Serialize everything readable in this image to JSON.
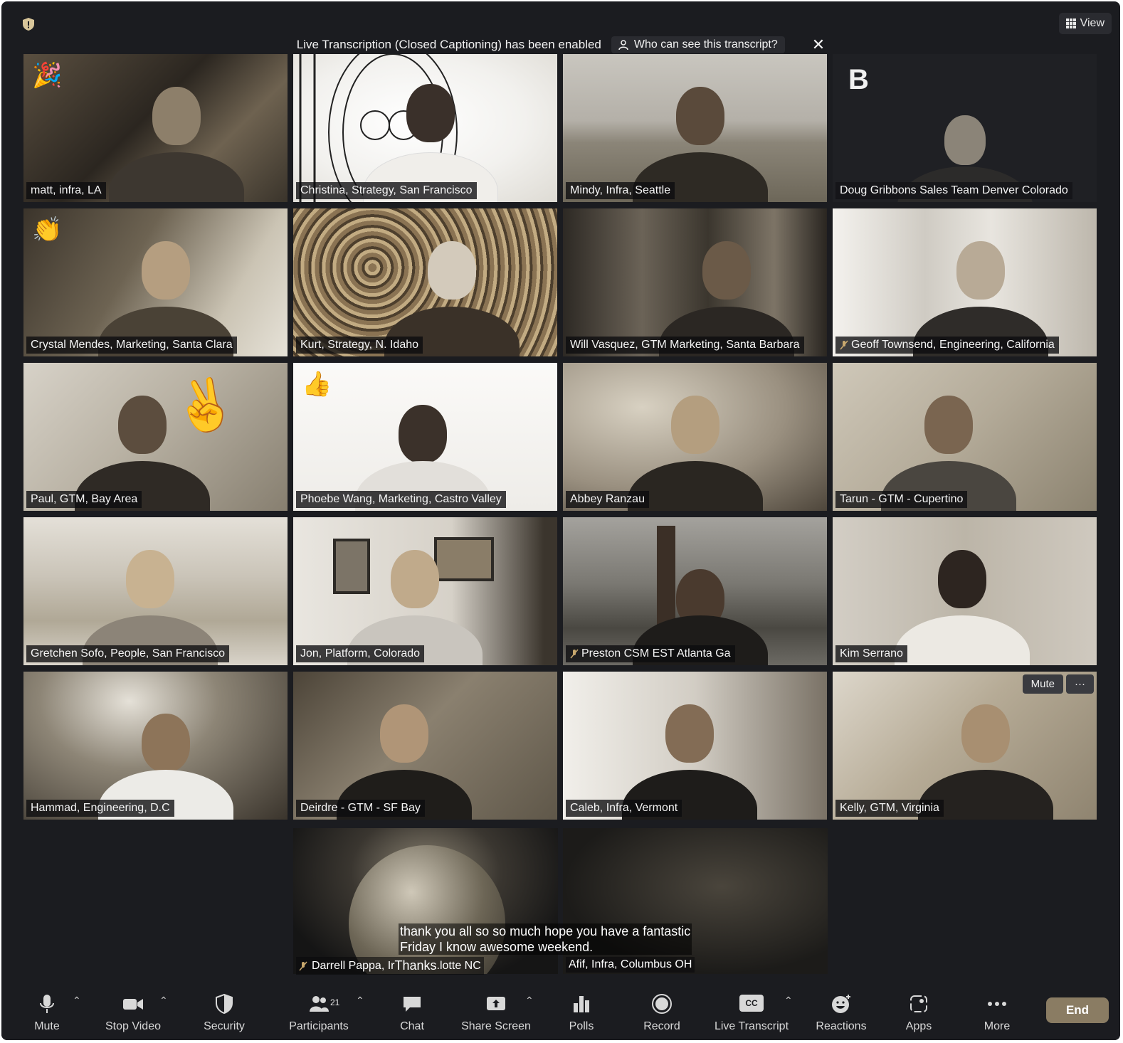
{
  "banner": {
    "message": "Live Transcription (Closed Captioning) has been enabled",
    "who_label": "Who can see this transcript?"
  },
  "view_button": {
    "label": "View"
  },
  "tiles": [
    {
      "name": "matt, infra, LA"
    },
    {
      "name": "Christina, Strategy, San Francisco"
    },
    {
      "name": "Mindy, Infra, Seattle"
    },
    {
      "name": "Doug Gribbons Sales Team Denver Colorado",
      "logo_text": "B"
    },
    {
      "name": "Crystal Mendes, Marketing, Santa Clara"
    },
    {
      "name": "Kurt, Strategy, N. Idaho"
    },
    {
      "name": "Will Vasquez, GTM Marketing, Santa Barbara"
    },
    {
      "name": "Geoff Townsend, Engineering, California"
    },
    {
      "name": "Paul, GTM, Bay Area"
    },
    {
      "name": "Phoebe Wang, Marketing, Castro Valley"
    },
    {
      "name": "Abbey Ranzau"
    },
    {
      "name": "Tarun - GTM - Cupertino"
    },
    {
      "name": "Gretchen Sofo, People, San Francisco"
    },
    {
      "name": "Jon, Platform, Colorado"
    },
    {
      "name": "Preston CSM EST Atlanta Ga"
    },
    {
      "name": "Kim Serrano"
    },
    {
      "name": "Hammad, Engineering, D.C"
    },
    {
      "name": "Deirdre - GTM - SF Bay"
    },
    {
      "name": "Caleb, Infra, Vermont"
    },
    {
      "name": "Kelly, GTM, Virginia",
      "mute_label": "Mute",
      "more_label": "···"
    }
  ],
  "bottom_tiles": [
    {
      "name": "Darrell Pappa, Ir"
    },
    {
      "name": "Afif, Infra, Columbus OH"
    }
  ],
  "caption": {
    "line1": "thank you all so so much hope you have a fantastic",
    "line2": "Friday I know awesome weekend.",
    "overlap_word": "Thanks",
    "overlap_tail": ".lotte NC"
  },
  "toolbar": {
    "mute": "Mute",
    "stop_video": "Stop Video",
    "security": "Security",
    "participants": "Participants",
    "participants_count": "21",
    "chat": "Chat",
    "share_screen": "Share Screen",
    "polls": "Polls",
    "record": "Record",
    "live_transcript": "Live Transcript",
    "cc": "CC",
    "reactions": "Reactions",
    "apps": "Apps",
    "more": "More",
    "end": "End"
  }
}
